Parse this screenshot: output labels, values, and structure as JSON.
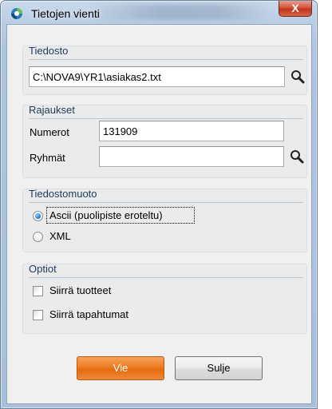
{
  "window": {
    "title": "Tietojen vienti",
    "close_label": "X"
  },
  "file_group": {
    "title": "Tiedosto",
    "path_value": "C:\\NOVA9\\YR1\\asiakas2.txt"
  },
  "limits_group": {
    "title": "Rajaukset",
    "number_label": "Numerot",
    "number_value": "131909",
    "group_label": "Ryhmät",
    "group_value": ""
  },
  "format_group": {
    "title": "Tiedostomuoto",
    "options": [
      {
        "label": "Ascii (puolipiste eroteltu)",
        "selected": true
      },
      {
        "label": "XML",
        "selected": false
      }
    ]
  },
  "options_group": {
    "title": "Optiot",
    "checkboxes": [
      {
        "label": "Siirrä tuotteet",
        "checked": false
      },
      {
        "label": "Siirrä tapahtumat",
        "checked": false
      }
    ]
  },
  "buttons": {
    "export_label": "Vie",
    "close_label": "Sulje"
  },
  "colors": {
    "primary_button": "#ee7d22",
    "group_title": "#1e395b"
  },
  "icons": [
    "app-icon",
    "close-icon",
    "search-icon"
  ]
}
